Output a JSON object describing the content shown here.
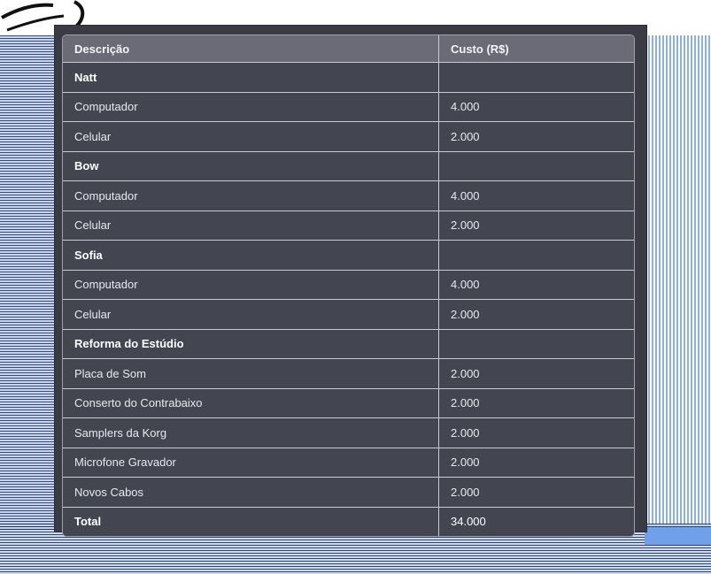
{
  "table": {
    "headers": [
      "Descrição",
      "Custo (R$)"
    ],
    "rows": [
      {
        "type": "group",
        "label": "Natt",
        "value": ""
      },
      {
        "type": "item",
        "label": "Computador",
        "value": "4.000"
      },
      {
        "type": "item",
        "label": "Celular",
        "value": "2.000"
      },
      {
        "type": "group",
        "label": "Bow",
        "value": ""
      },
      {
        "type": "item",
        "label": "Computador",
        "value": "4.000"
      },
      {
        "type": "item",
        "label": "Celular",
        "value": "2.000"
      },
      {
        "type": "group",
        "label": "Sofia",
        "value": ""
      },
      {
        "type": "item",
        "label": "Computador",
        "value": "4.000"
      },
      {
        "type": "item",
        "label": "Celular",
        "value": "2.000"
      },
      {
        "type": "group",
        "label": "Reforma do Estúdio",
        "value": ""
      },
      {
        "type": "item",
        "label": "Placa de Som",
        "value": "2.000"
      },
      {
        "type": "item",
        "label": "Conserto do Contrabaixo",
        "value": "2.000"
      },
      {
        "type": "item",
        "label": "Samplers da Korg",
        "value": "2.000"
      },
      {
        "type": "item",
        "label": "Microfone Gravador",
        "value": "2.000"
      },
      {
        "type": "item",
        "label": "Novos Cabos",
        "value": "2.000"
      },
      {
        "type": "total",
        "label": "Total",
        "value": "34.000"
      }
    ]
  },
  "colors": {
    "panel": "#3a3b45",
    "header": "#6a6b76",
    "row": "#434551",
    "border": "#c9cad2"
  }
}
